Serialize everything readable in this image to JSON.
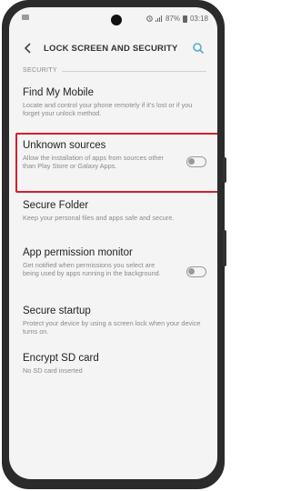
{
  "status_bar": {
    "battery_percent": "87%",
    "time": "03:18"
  },
  "header": {
    "title": "LOCK SCREEN AND SECURITY",
    "back_icon": "chevron-left-icon",
    "search_icon": "search-icon"
  },
  "section": {
    "label": "SECURITY"
  },
  "items": [
    {
      "title": "Find My Mobile",
      "subtitle": "Locate and control your phone remotely if it's lost or if you forget your unlock method."
    },
    {
      "title": "Unknown sources",
      "subtitle": "Allow the installation of apps from sources other than Play Store or Galaxy Apps.",
      "toggle_on": false
    },
    {
      "title": "Secure Folder",
      "subtitle": "Keep your personal files and apps safe and secure."
    },
    {
      "title": "App permission monitor",
      "subtitle": "Get notified when permissions you select are being used by apps running in the background.",
      "toggle_on": false
    },
    {
      "title": "Secure startup",
      "subtitle": "Protect your device by using a screen lock when your device turns on."
    },
    {
      "title": "Encrypt SD card",
      "subtitle": "No SD card inserted"
    }
  ],
  "colors": {
    "accent": "#5aa8c8",
    "highlight": "#d0202e"
  }
}
